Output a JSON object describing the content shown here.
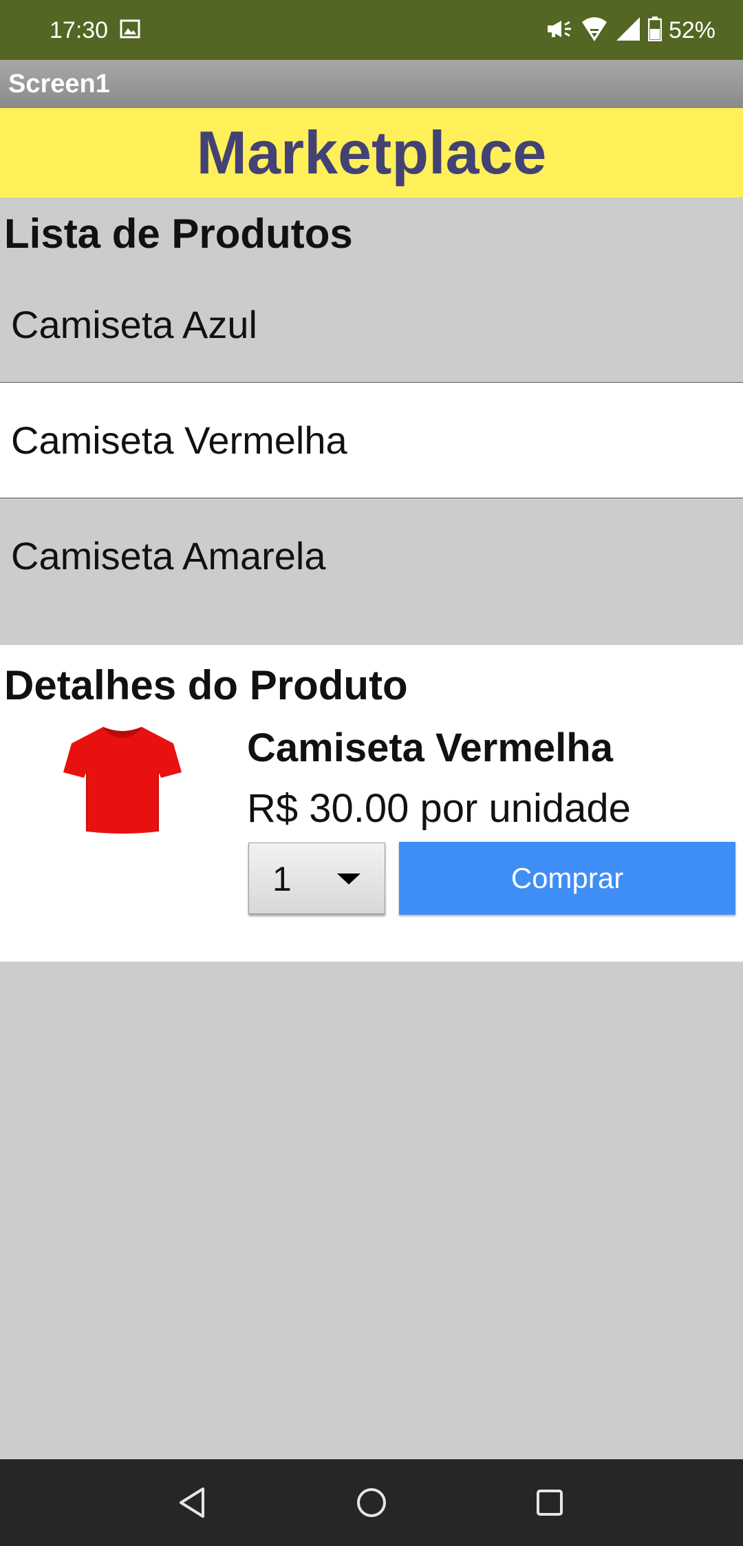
{
  "status_bar": {
    "time": "17:30",
    "battery": "52%",
    "icons": [
      "image-icon",
      "megaphone-icon",
      "wifi-icon",
      "signal-icon",
      "battery-icon"
    ]
  },
  "app": {
    "title": "Screen1"
  },
  "banner": {
    "title": "Marketplace"
  },
  "product_list": {
    "heading": "Lista de Produtos",
    "items": [
      {
        "label": "Camiseta Azul"
      },
      {
        "label": "Camiseta Vermelha",
        "selected": true
      },
      {
        "label": "Camiseta Amarela"
      }
    ]
  },
  "details": {
    "heading": "Detalhes do Produto",
    "name": "Camiseta Vermelha",
    "price": "R$ 30.00 por unidade",
    "quantity": "1",
    "buy_label": "Comprar",
    "image_icon": "red-tshirt-image"
  },
  "colors": {
    "status_bar": "#536623",
    "banner_bg": "#fff05a",
    "banner_text": "#434274",
    "buy_button": "#3f8ef5",
    "background": "#cccccc",
    "nav_bar": "#262626"
  },
  "nav_bar": {
    "icons": [
      "back-icon",
      "home-icon",
      "recents-icon"
    ]
  }
}
